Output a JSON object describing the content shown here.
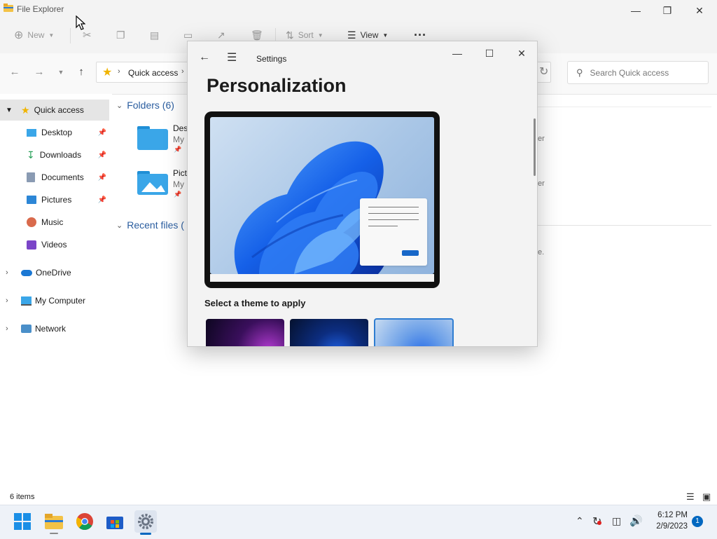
{
  "file_explorer": {
    "title": "File Explorer",
    "toolbar": {
      "new_label": "New",
      "sort_label": "Sort",
      "view_label": "View",
      "more_label": "···"
    },
    "address": {
      "crumb": "Quick access"
    },
    "search": {
      "placeholder": "Search Quick access"
    },
    "sidebar": {
      "items": [
        {
          "label": "Quick access"
        },
        {
          "label": "Desktop"
        },
        {
          "label": "Downloads"
        },
        {
          "label": "Documents"
        },
        {
          "label": "Pictures"
        },
        {
          "label": "Music"
        },
        {
          "label": "Videos"
        },
        {
          "label": "OneDrive"
        },
        {
          "label": "My Computer"
        },
        {
          "label": "Network"
        }
      ]
    },
    "main": {
      "folders_header": "Folders (6)",
      "recent_header": "Recent files (",
      "folders": [
        {
          "name": "Desk",
          "sub": "My"
        },
        {
          "name": "Pict",
          "sub": "My"
        }
      ],
      "right_fragments": [
        "er",
        "er",
        "e."
      ]
    },
    "status": {
      "items": "6 items"
    }
  },
  "settings": {
    "title": "Settings",
    "heading": "Personalization",
    "theme_label": "Select a theme to apply"
  },
  "taskbar": {
    "time": "6:12 PM",
    "date": "2/9/2023",
    "notification_count": "1"
  },
  "colors": {
    "accent": "#0067c0",
    "folder_blue": "#3aa6e8",
    "star": "#f6c53d"
  }
}
